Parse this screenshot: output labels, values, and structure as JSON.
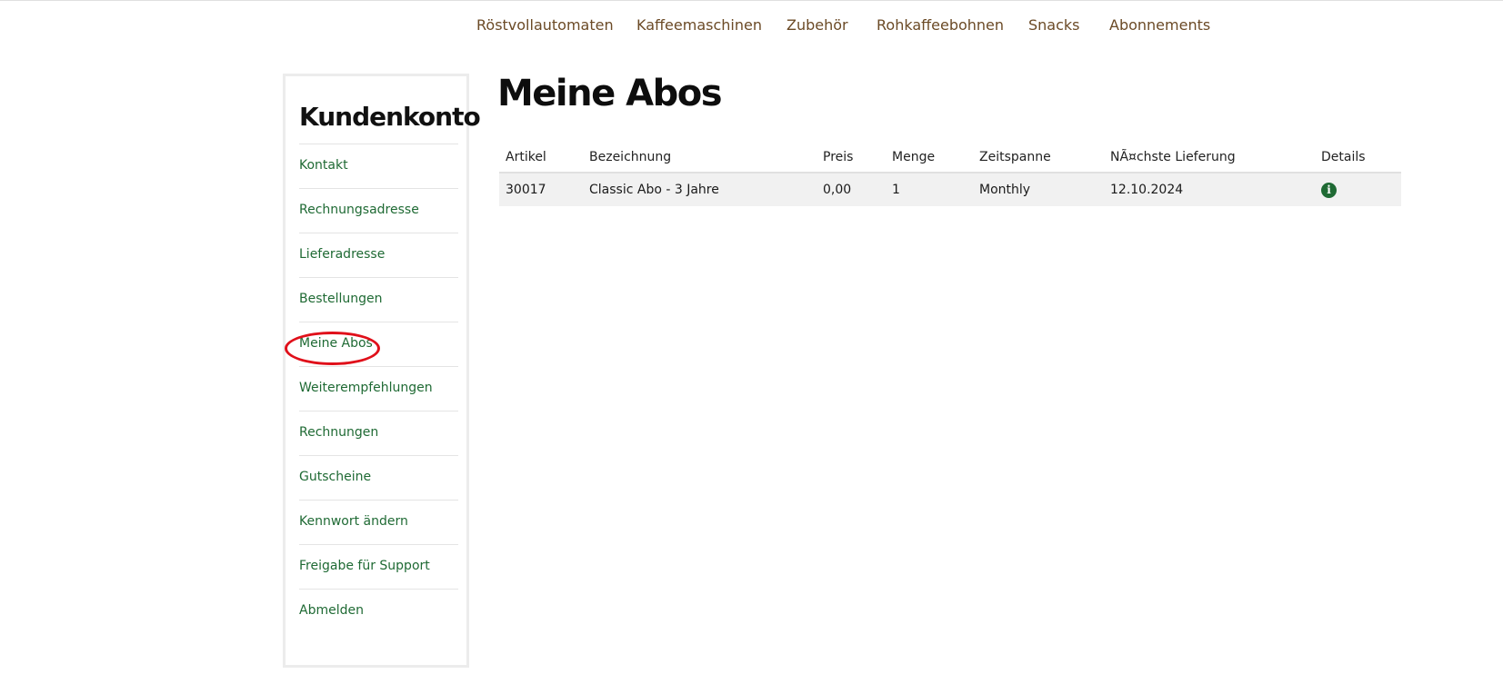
{
  "nav": {
    "items": [
      {
        "label": "Röstvollautomaten"
      },
      {
        "label": "Kaffeemaschinen"
      },
      {
        "label": "Zubehör"
      },
      {
        "label": "Rohkaffeebohnen"
      },
      {
        "label": "Snacks"
      },
      {
        "label": "Abonnements"
      }
    ]
  },
  "sidebar": {
    "title": "Kundenkonto",
    "items": [
      {
        "label": "Kontakt"
      },
      {
        "label": "Rechnungsadresse"
      },
      {
        "label": "Lieferadresse"
      },
      {
        "label": "Bestellungen"
      },
      {
        "label": "Meine Abos",
        "highlighted": true
      },
      {
        "label": "Weiterempfehlungen"
      },
      {
        "label": "Rechnungen"
      },
      {
        "label": "Gutscheine"
      },
      {
        "label": "Kennwort ändern"
      },
      {
        "label": "Freigabe für Support"
      },
      {
        "label": "Abmelden"
      }
    ]
  },
  "main": {
    "title": "Meine Abos",
    "table": {
      "headers": [
        "Artikel",
        "Bezeichnung",
        "Preis",
        "Menge",
        "Zeitspanne",
        "NÃ¤chste Lieferung",
        "Details"
      ],
      "rows": [
        {
          "artikel": "30017",
          "bezeichnung": "Classic Abo - 3 Jahre",
          "preis": "0,00",
          "menge": "1",
          "zeitspanne": "Monthly",
          "naechste_lieferung": "12.10.2024",
          "details_icon": "info-circle-icon"
        }
      ]
    }
  },
  "colors": {
    "nav_text": "#6b4a26",
    "link_green": "#1f6a34",
    "highlight_circle": "#e0101a",
    "row_background": "#f1f1f1"
  }
}
